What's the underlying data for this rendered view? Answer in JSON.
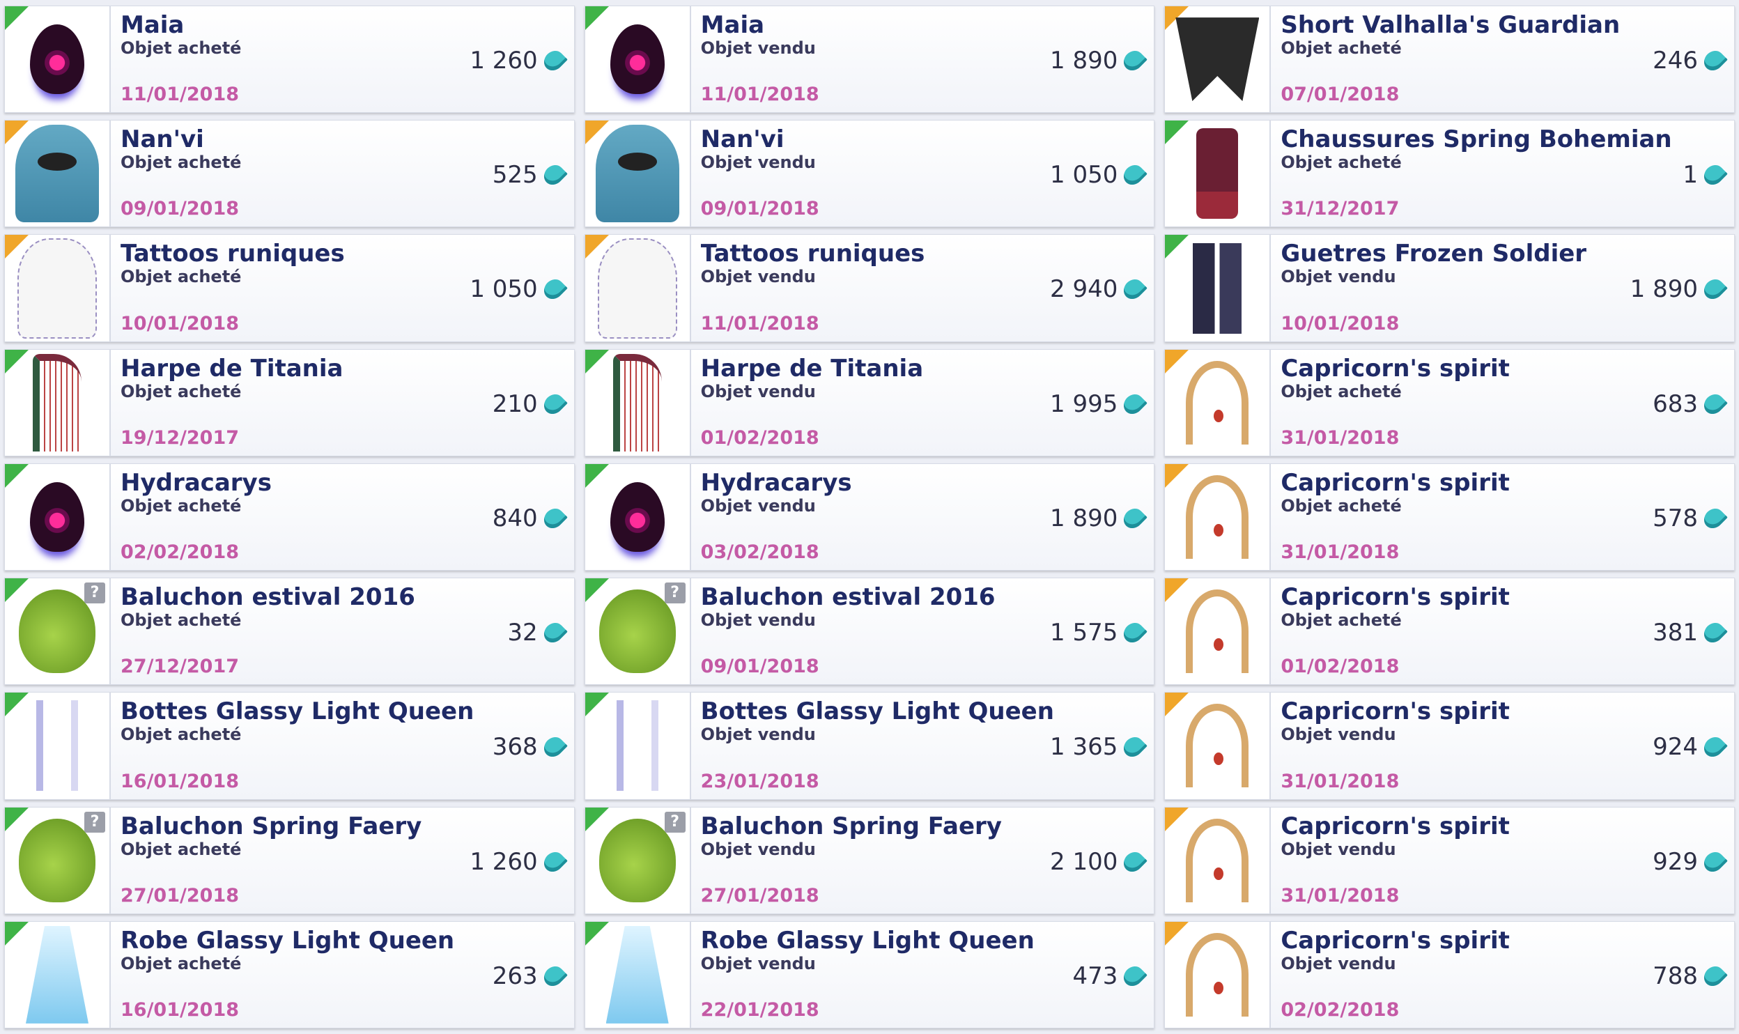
{
  "currency": {
    "icon": "maana-icon",
    "color": "#3ec3c8"
  },
  "columns": [
    {
      "cards": [
        {
          "name": "Maia",
          "status": "Objet acheté",
          "price": "1 260",
          "date": "11/01/2018",
          "flag": "green",
          "thumb": "egg",
          "unknown": false
        },
        {
          "name": "Nan'vi",
          "status": "Objet acheté",
          "price": "525",
          "date": "09/01/2018",
          "flag": "orange",
          "thumb": "body-blue",
          "unknown": false
        },
        {
          "name": "Tattoos runiques",
          "status": "Objet acheté",
          "price": "1 050",
          "date": "10/01/2018",
          "flag": "orange",
          "thumb": "tattoo",
          "unknown": false
        },
        {
          "name": "Harpe de Titania",
          "status": "Objet acheté",
          "price": "210",
          "date": "19/12/2017",
          "flag": "green",
          "thumb": "harp",
          "unknown": false
        },
        {
          "name": "Hydracarys",
          "status": "Objet acheté",
          "price": "840",
          "date": "02/02/2018",
          "flag": "green",
          "thumb": "egg",
          "unknown": false
        },
        {
          "name": "Baluchon estival 2016",
          "status": "Objet acheté",
          "price": "32",
          "date": "27/12/2017",
          "flag": "green",
          "thumb": "bag",
          "unknown": true
        },
        {
          "name": "Bottes Glassy Light Queen",
          "status": "Objet acheté",
          "price": "368",
          "date": "16/01/2018",
          "flag": "green",
          "thumb": "boots",
          "unknown": false
        },
        {
          "name": "Baluchon Spring Faery",
          "status": "Objet acheté",
          "price": "1 260",
          "date": "27/01/2018",
          "flag": "green",
          "thumb": "bag",
          "unknown": true
        },
        {
          "name": "Robe Glassy Light Queen",
          "status": "Objet acheté",
          "price": "263",
          "date": "16/01/2018",
          "flag": "green",
          "thumb": "robe",
          "unknown": false
        }
      ]
    },
    {
      "cards": [
        {
          "name": "Maia",
          "status": "Objet vendu",
          "price": "1 890",
          "date": "11/01/2018",
          "flag": "green",
          "thumb": "egg",
          "unknown": false
        },
        {
          "name": "Nan'vi",
          "status": "Objet vendu",
          "price": "1 050",
          "date": "09/01/2018",
          "flag": "orange",
          "thumb": "body-blue",
          "unknown": false
        },
        {
          "name": "Tattoos runiques",
          "status": "Objet vendu",
          "price": "2 940",
          "date": "11/01/2018",
          "flag": "orange",
          "thumb": "tattoo",
          "unknown": false
        },
        {
          "name": "Harpe de Titania",
          "status": "Objet vendu",
          "price": "1 995",
          "date": "01/02/2018",
          "flag": "green",
          "thumb": "harp",
          "unknown": false
        },
        {
          "name": "Hydracarys",
          "status": "Objet vendu",
          "price": "1 890",
          "date": "03/02/2018",
          "flag": "green",
          "thumb": "egg",
          "unknown": false
        },
        {
          "name": "Baluchon estival 2016",
          "status": "Objet vendu",
          "price": "1 575",
          "date": "09/01/2018",
          "flag": "green",
          "thumb": "bag",
          "unknown": true
        },
        {
          "name": "Bottes Glassy Light Queen",
          "status": "Objet vendu",
          "price": "1 365",
          "date": "23/01/2018",
          "flag": "green",
          "thumb": "boots",
          "unknown": false
        },
        {
          "name": "Baluchon Spring Faery",
          "status": "Objet vendu",
          "price": "2 100",
          "date": "27/01/2018",
          "flag": "green",
          "thumb": "bag",
          "unknown": true
        },
        {
          "name": "Robe Glassy Light Queen",
          "status": "Objet vendu",
          "price": "473",
          "date": "22/01/2018",
          "flag": "green",
          "thumb": "robe",
          "unknown": false
        }
      ]
    },
    {
      "cards": [
        {
          "name": "Short Valhalla's Guardian",
          "status": "Objet acheté",
          "price": "246",
          "date": "07/01/2018",
          "flag": "orange",
          "thumb": "dark-short",
          "unknown": false
        },
        {
          "name": "Chaussures Spring Bohemian",
          "status": "Objet acheté",
          "price": "1",
          "date": "31/12/2017",
          "flag": "green",
          "thumb": "red-shoes",
          "unknown": false
        },
        {
          "name": "Guetres Frozen Soldier",
          "status": "Objet vendu",
          "price": "1 890",
          "date": "10/01/2018",
          "flag": "green",
          "thumb": "gaiters",
          "unknown": false
        },
        {
          "name": "Capricorn's spirit",
          "status": "Objet acheté",
          "price": "683",
          "date": "31/01/2018",
          "flag": "orange",
          "thumb": "horns",
          "unknown": false
        },
        {
          "name": "Capricorn's spirit",
          "status": "Objet acheté",
          "price": "578",
          "date": "31/01/2018",
          "flag": "orange",
          "thumb": "horns",
          "unknown": false
        },
        {
          "name": "Capricorn's spirit",
          "status": "Objet acheté",
          "price": "381",
          "date": "01/02/2018",
          "flag": "orange",
          "thumb": "horns",
          "unknown": false
        },
        {
          "name": "Capricorn's spirit",
          "status": "Objet vendu",
          "price": "924",
          "date": "31/01/2018",
          "flag": "orange",
          "thumb": "horns",
          "unknown": false
        },
        {
          "name": "Capricorn's spirit",
          "status": "Objet vendu",
          "price": "929",
          "date": "31/01/2018",
          "flag": "orange",
          "thumb": "horns",
          "unknown": false
        },
        {
          "name": "Capricorn's spirit",
          "status": "Objet vendu",
          "price": "788",
          "date": "02/02/2018",
          "flag": "orange",
          "thumb": "horns",
          "unknown": false
        }
      ]
    }
  ]
}
